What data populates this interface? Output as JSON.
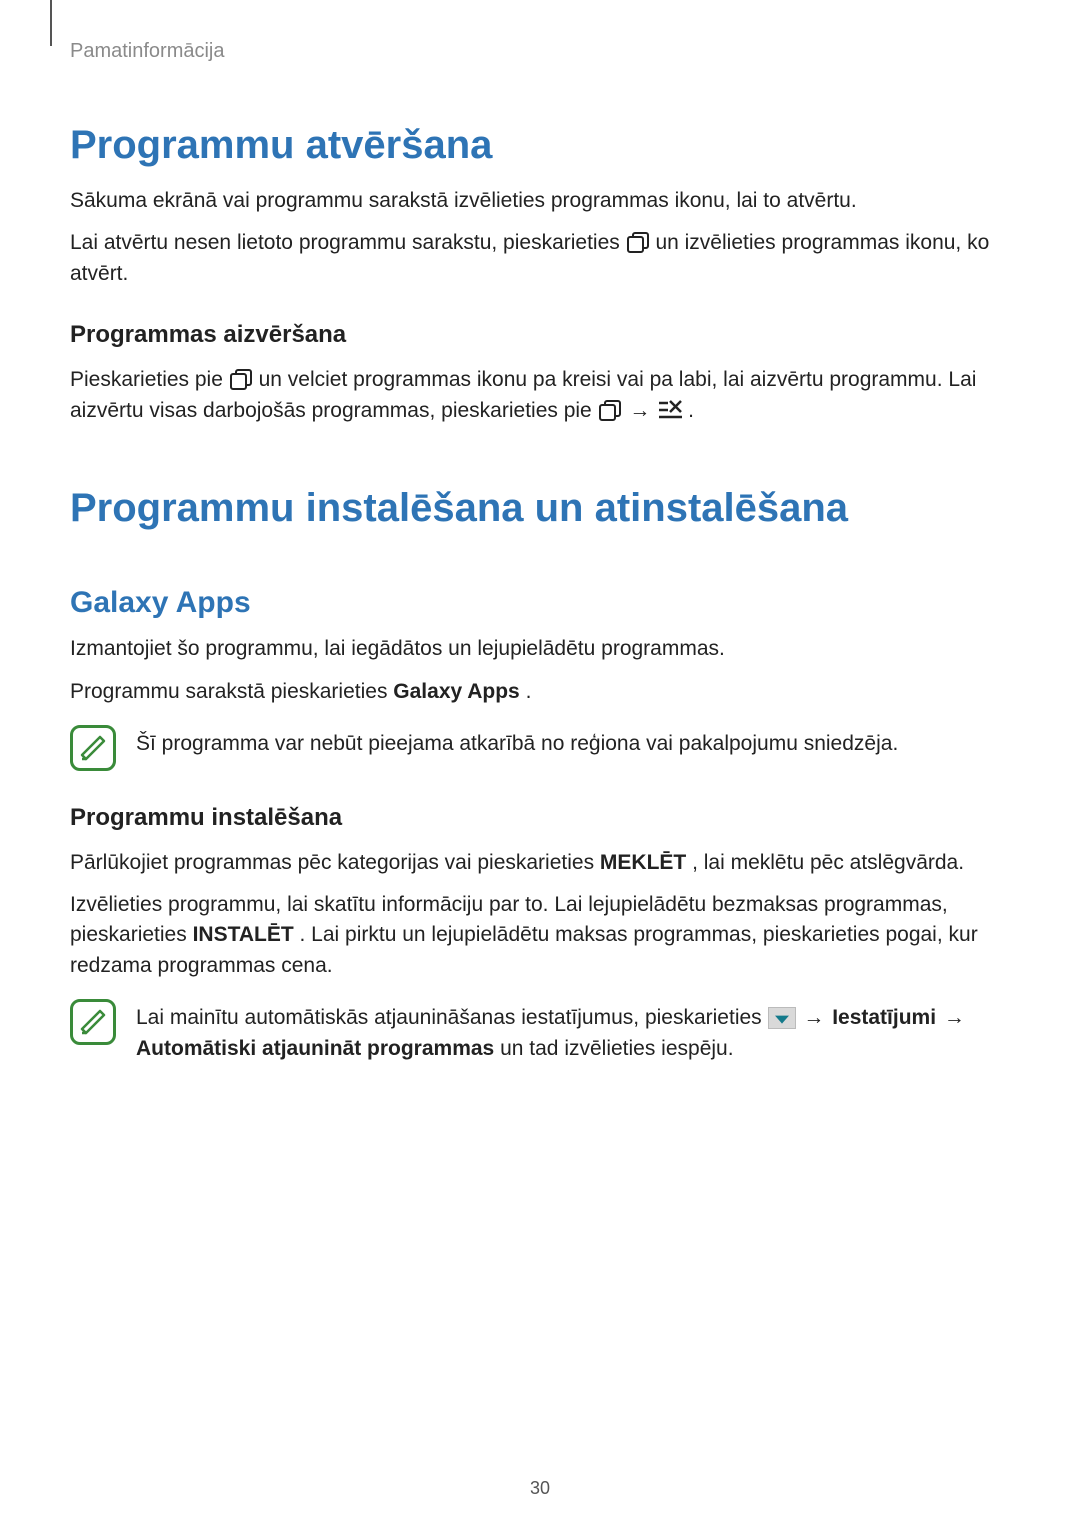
{
  "header": "Pamatinformācija",
  "pageNumber": "30",
  "s1": {
    "title": "Programmu atvēršana",
    "p1": "Sākuma ekrānā vai programmu sarakstā izvēlieties programmas ikonu, lai to atvērtu.",
    "p2a": "Lai atvērtu nesen lietoto programmu sarakstu, pieskarieties ",
    "p2b": " un izvēlieties programmas ikonu, ko atvērt.",
    "sub1": {
      "title": "Programmas aizvēršana",
      "p1a": "Pieskarieties pie ",
      "p1b": " un velciet programmas ikonu pa kreisi vai pa labi, lai aizvērtu programmu. Lai aizvērtu visas darbojošās programmas, pieskarieties pie ",
      "p1c": " → ",
      "p1d": "."
    }
  },
  "s2": {
    "title": "Programmu instalēšana un atinstalēšana",
    "sub1": {
      "title": "Galaxy Apps",
      "p1": "Izmantojiet šo programmu, lai iegādātos un lejupielādētu programmas.",
      "p2a": "Programmu sarakstā pieskarieties ",
      "p2b": "Galaxy Apps",
      "p2c": ".",
      "note": "Šī programma var nebūt pieejama atkarībā no reģiona vai pakalpojumu sniedzēja."
    },
    "sub2": {
      "title": "Programmu instalēšana",
      "p1a": "Pārlūkojiet programmas pēc kategorijas vai pieskarieties ",
      "p1b": "MEKLĒT",
      "p1c": ", lai meklētu pēc atslēgvārda.",
      "p2a": "Izvēlieties programmu, lai skatītu informāciju par to. Lai lejupielādētu bezmaksas programmas, pieskarieties ",
      "p2b": "INSTALĒT",
      "p2c": ". Lai pirktu un lejupielādētu maksas programmas, pieskarieties pogai, kur redzama programmas cena.",
      "noteA": "Lai mainītu automātiskās atjaunināšanas iestatījumus, pieskarieties ",
      "noteB": " → ",
      "noteC": "Iestatījumi",
      "noteD": " → ",
      "noteE": "Automātiski atjaunināt programmas",
      "noteF": " un tad izvēlieties iespēju."
    }
  }
}
